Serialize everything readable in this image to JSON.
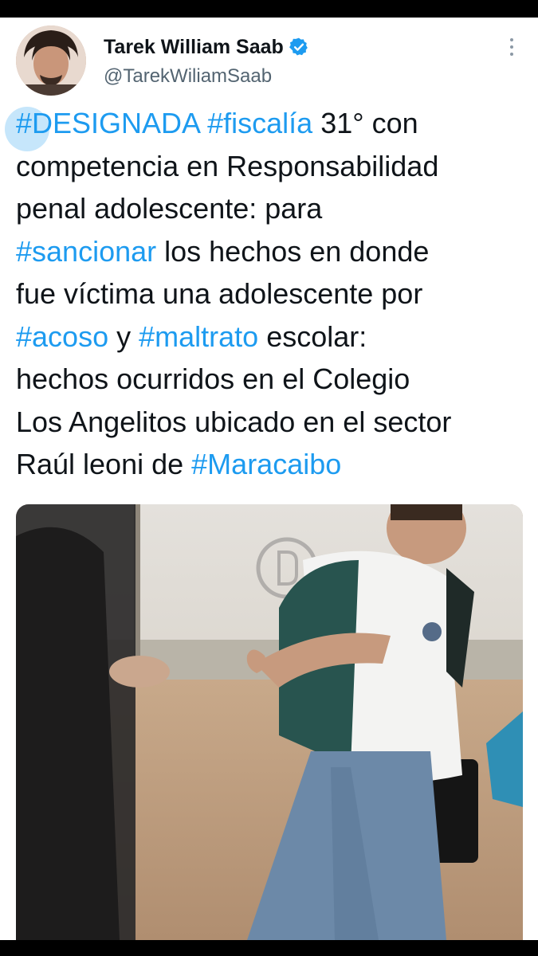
{
  "tweet": {
    "author": {
      "display_name": "Tarek William Saab",
      "handle": "@TarekWiliamSaab",
      "verified": true
    },
    "text_lines": [
      [
        {
          "t": "#DESIGNADA",
          "tag": true
        },
        {
          "t": " ",
          "tag": false
        },
        {
          "t": "#fiscalía",
          "tag": true
        },
        {
          "t": " 31° con",
          "tag": false
        }
      ],
      [
        {
          "t": "competencia en Responsabilidad",
          "tag": false
        }
      ],
      [
        {
          "t": "penal adolescente: para",
          "tag": false
        }
      ],
      [
        {
          "t": "#sancionar",
          "tag": true
        },
        {
          "t": " los hechos en donde",
          "tag": false
        }
      ],
      [
        {
          "t": "fue víctima una adolescente por",
          "tag": false
        }
      ],
      [
        {
          "t": "#acoso",
          "tag": true
        },
        {
          "t": " y ",
          "tag": false
        },
        {
          "t": "#maltrato",
          "tag": true
        },
        {
          "t": " escolar:",
          "tag": false
        }
      ],
      [
        {
          "t": "hechos ocurridos en el Colegio",
          "tag": false
        }
      ],
      [
        {
          "t": "Los Angelitos ubicado en el sector",
          "tag": false
        }
      ],
      [
        {
          "t": "Raúl leoni de ",
          "tag": false
        },
        {
          "t": "#Maracaibo",
          "tag": true
        }
      ]
    ],
    "media": {
      "watermark": "DM"
    }
  },
  "colors": {
    "hashtag": "#1d9bf0",
    "text": "#0f1419",
    "secondary": "#536471",
    "verified_badge": "#1d9bf0"
  },
  "icons": {
    "verified": "verified-badge-icon",
    "more": "more-options-icon"
  }
}
